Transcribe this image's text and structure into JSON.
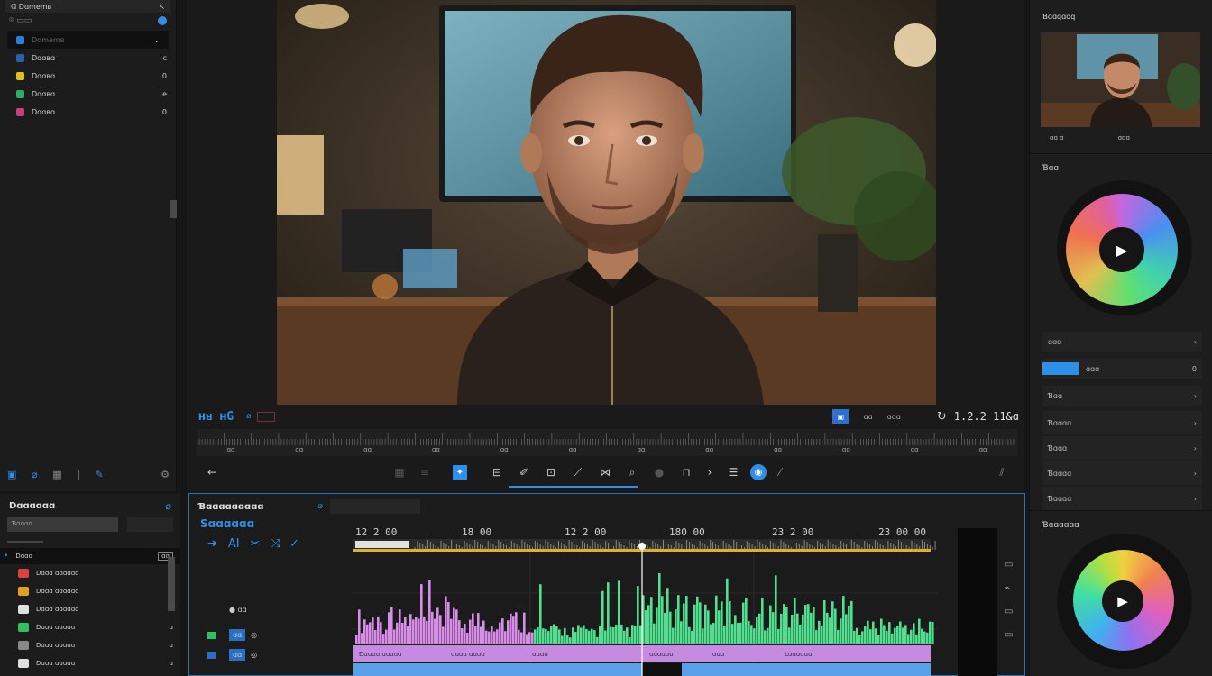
{
  "left_browser": {
    "title": "Ɑ Dɑmemʙ",
    "items": [
      {
        "label": "Dɑmemʙ",
        "color": "#2c7fd8",
        "action": "⌄"
      },
      {
        "label": "Dɑɑʙɑ",
        "color": "#2a5fb0",
        "action": "c"
      },
      {
        "label": "Dɑɑʙɑ",
        "color": "#e0c020",
        "action": "0"
      },
      {
        "label": "Dɑɑʙɑ",
        "color": "#2ab060",
        "action": "e"
      },
      {
        "label": "Dɑɑʙɑ",
        "color": "#c04080",
        "action": "0"
      }
    ]
  },
  "viewer": {
    "timecode_left": "ʜᴚ ʜG",
    "timecode_right": "1.2.2 11&ɑ",
    "ruler_marks": [
      "ɑɑ",
      "ɑɑ",
      "ɑɑ",
      "ɑɑ",
      "ɑɑ",
      "ɑɑ",
      "ɑɑ",
      "ɑɑ",
      "ɑɑ",
      "ɑɑ",
      "ɑɑ",
      "ɑɑ"
    ],
    "btn_a": "ɑɑ",
    "btn_b": "ɑɑɑ"
  },
  "right_panel": {
    "preview_title": "Ɓɑɑqɑɑq",
    "preview_meta_a": "ɑɑ ɑ",
    "preview_meta_b": "ɑɑɑ",
    "scope_title": "Ɓɑɑ",
    "rows": [
      {
        "label": "ɑɑɑ",
        "value": "›"
      },
      {
        "label": "ɑɑɑ",
        "value": "0"
      },
      {
        "label": "Ɓɑɑ",
        "value": "›"
      },
      {
        "label": "Ɓɑɑɑɑ",
        "value": "›"
      },
      {
        "label": "Ɓɑɑɑ",
        "value": "›"
      },
      {
        "label": "Ɓɑɑɑɑ",
        "value": "›"
      },
      {
        "label": "Ɓɑɑɑɑ",
        "value": "›"
      }
    ],
    "second_scope_title": "Ɓɑɑɑɑɑɑ"
  },
  "bottom_left": {
    "title": "Dɑɑɑɑɑɑ",
    "search_placeholder": "Ɓɑɑɑɑ",
    "group_label": "Dɑɑɑ",
    "group_badge": "ɑɑ",
    "items": [
      {
        "label": "Dɑɑɑ ɑɑɑɑɑɑ",
        "color": "#e04040",
        "v": "ɑ"
      },
      {
        "label": "Dɑɑɑ ɑɑɑɑɑɑ",
        "color": "#e0a020",
        "v": "ɑ"
      },
      {
        "label": "Dɑɑɑ ɑɑɑɑɑɑ",
        "color": "#e0e0e0",
        "v": "ɑ"
      },
      {
        "label": "Dɑɑɑ ɑɑɑɑɑ",
        "color": "#30c060",
        "v": "ɑ"
      },
      {
        "label": "Dɑɑɑ ɑɑɑɑɑ",
        "color": "#888888",
        "v": "ɑ"
      },
      {
        "label": "Dɑɑɑ ɑɑɑɑɑ",
        "color": "#e0e0e0",
        "v": "ɑ"
      }
    ]
  },
  "timeline": {
    "title": "Ɓɑɑɑɑɑɑɑɑɑ",
    "subtitle": "Sɑɑɑɑɑɑ",
    "timestamps": [
      "12 2 00",
      "18 00",
      "12 2 00",
      "180 00",
      "23 2 00",
      "23 00 00"
    ],
    "track_label_a": "ɑɑ",
    "track_label_b": "ɑɑ",
    "clip_labels": [
      "Dɑɑɑɑ ɑɑɑɑɑ",
      "ɑɑɑɑ ɑɑɑɑ",
      "ɑɑɑɑ",
      "ɑɑɑɑɑɑ",
      "ɑɑɑ",
      "Lɑɑɑɑɑɑ"
    ]
  }
}
